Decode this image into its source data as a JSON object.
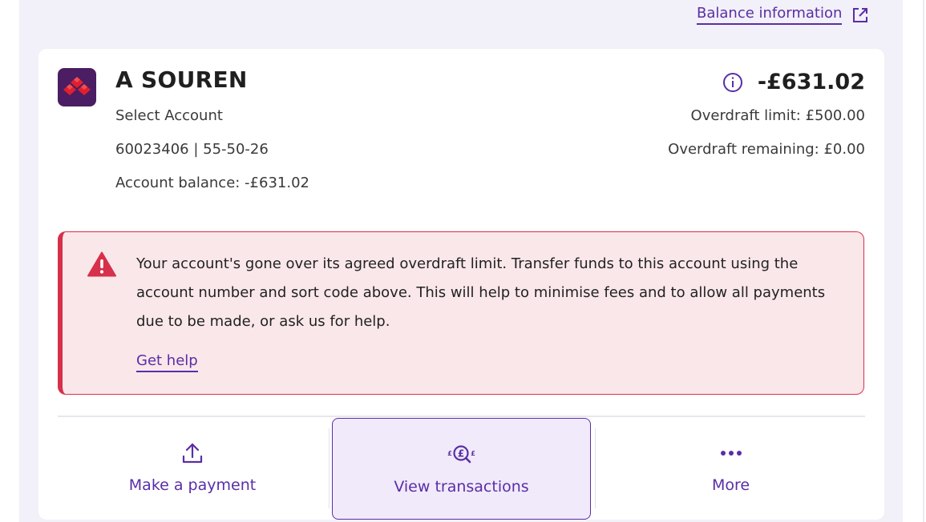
{
  "header": {
    "balance_info_link": "Balance information",
    "external_icon": "external-link-icon"
  },
  "account": {
    "name": "A SOUREN",
    "logo_icon": "natwest-logo",
    "type": "Select Account",
    "number_sort": "60023406 | 55-50-26",
    "balance_text": "Account balance: -£631.02",
    "big_balance": "-£631.02",
    "overdraft_limit": "Overdraft limit: £500.00",
    "overdraft_remaining": "Overdraft remaining: £0.00"
  },
  "alert": {
    "icon": "warning-icon",
    "message": "Your account's gone over its agreed overdraft limit. Transfer funds to this account using the account number and sort code above. This will help to minimise fees and to allow all payments due to be made, or ask us for help.",
    "help_link": "Get help"
  },
  "actions": [
    {
      "label": "Make a payment",
      "icon": "upload-icon"
    },
    {
      "label": "View transactions",
      "icon": "transactions-search-icon"
    },
    {
      "label": "More",
      "icon": "more-dots-icon"
    }
  ],
  "colors": {
    "brand_purple": "#5a2ea6",
    "alert_red": "#d7304a",
    "alert_bg": "#fae7ea",
    "logo_bg": "#4b1d62"
  }
}
